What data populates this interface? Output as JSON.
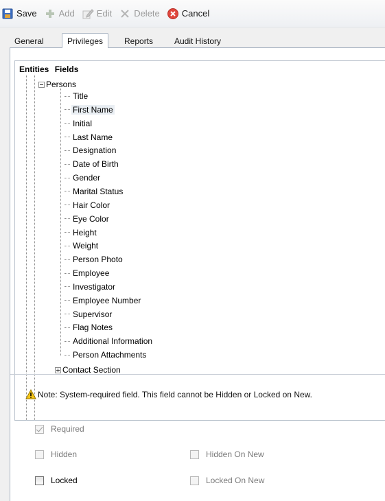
{
  "toolbar": {
    "save": "Save",
    "add": "Add",
    "edit": "Edit",
    "delete": "Delete",
    "cancel": "Cancel"
  },
  "tabs": {
    "general": "General",
    "privileges": "Privileges",
    "reports": "Reports",
    "audit_history": "Audit History"
  },
  "tree": {
    "header_entities": "Entities",
    "header_fields": "Fields",
    "root": "Persons",
    "items": [
      "Title",
      "First Name",
      "Initial",
      "Last Name",
      "Designation",
      "Date of Birth",
      "Gender",
      "Marital Status",
      "Hair Color",
      "Eye Color",
      "Height",
      "Weight",
      "Person Photo",
      "Employee",
      "Investigator",
      "Employee Number",
      "Supervisor",
      "Flag Notes",
      "Additional Information",
      "Person Attachments"
    ],
    "selected_item": "First Name",
    "next_root": "Contact Section"
  },
  "note": "Note: System-required field. This field cannot be Hidden or Locked on New.",
  "options": {
    "required": {
      "label": "Required",
      "checked": true,
      "enabled": false
    },
    "hidden": {
      "label": "Hidden",
      "checked": false,
      "enabled": false
    },
    "hidden_on_new": {
      "label": "Hidden On New",
      "checked": false,
      "enabled": false
    },
    "locked": {
      "label": "Locked",
      "checked": false,
      "enabled": true
    },
    "locked_on_new": {
      "label": "Locked On New",
      "checked": false,
      "enabled": false
    }
  },
  "colors": {
    "cancel_red": "#e0463c",
    "save_blue": "#3c6fc4",
    "warning_yellow": "#f5c518"
  },
  "icons": {
    "save": "save-icon",
    "add": "add-icon",
    "edit": "edit-icon",
    "delete": "delete-icon",
    "cancel": "cancel-icon",
    "warning": "warning-icon"
  }
}
